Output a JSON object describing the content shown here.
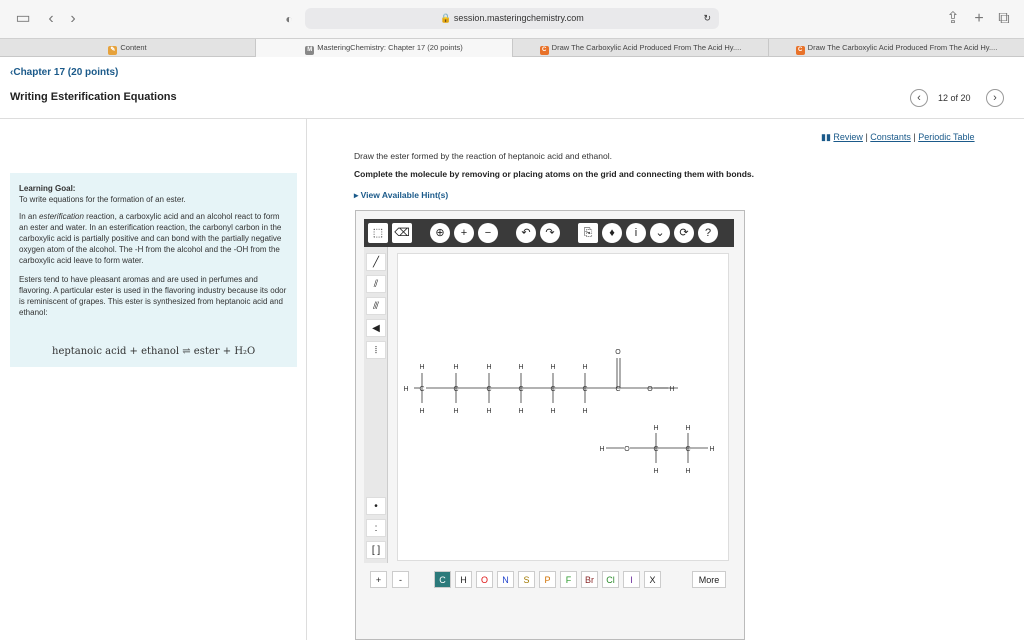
{
  "browser": {
    "url": "session.masteringchemistry.com",
    "tabs": [
      {
        "label": "Content",
        "icon": "content-icon"
      },
      {
        "label": "MasteringChemistry: Chapter 17 (20 points)",
        "icon": "m-icon"
      },
      {
        "label": "Draw The Carboxylic Acid Produced From The Acid Hy....",
        "icon": "c-icon"
      },
      {
        "label": "Draw The Carboxylic Acid Produced From The Acid Hy....",
        "icon": "c-icon"
      }
    ]
  },
  "header": {
    "chapter_link": "Chapter 17 (20 points)",
    "title": "Writing Esterification Equations",
    "counter": "12 of 20"
  },
  "learning_goal": {
    "title": "Learning Goal:",
    "goal": "To write equations for the formation of an ester.",
    "para1_a": "In an ",
    "para1_term": "esterification",
    "para1_b": " reaction, a carboxylic acid and an alcohol react to form an ester and water. In an esterification reaction, the carbonyl carbon in the carboxylic acid is partially positive and can bond with the partially negative oxygen atom of the alcohol. The -H from the alcohol and the -OH from the carboxylic acid leave to form water.",
    "para2": "Esters tend to have pleasant aromas and are used in perfumes and flavoring. A particular ester is used in the flavoring industry because its odor is reminiscent of grapes. This ester is synthesized from heptanoic acid and ethanol:",
    "equation": "heptanoic acid + ethanol ⇌ ester + H₂O"
  },
  "links": {
    "review": "Review",
    "constants": "Constants",
    "periodic": "Periodic Table"
  },
  "question": "Draw the ester formed by the reaction of heptanoic acid and ethanol.",
  "instruction": "Complete the molecule by removing or placing atoms on the grid and connecting them with bonds.",
  "hints": "View Available Hint(s)",
  "atom_buttons": [
    {
      "label": "C",
      "color": "#ffffff",
      "bg": "#2c7a7b"
    },
    {
      "label": "H",
      "color": "#222222",
      "bg": "#ffffff"
    },
    {
      "label": "O",
      "color": "#d11",
      "bg": "#ffffff"
    },
    {
      "label": "N",
      "color": "#2244cc",
      "bg": "#ffffff"
    },
    {
      "label": "S",
      "color": "#a07800",
      "bg": "#ffffff"
    },
    {
      "label": "P",
      "color": "#d07000",
      "bg": "#ffffff"
    },
    {
      "label": "F",
      "color": "#2a9a2a",
      "bg": "#ffffff"
    },
    {
      "label": "Br",
      "color": "#8a2a2a",
      "bg": "#ffffff"
    },
    {
      "label": "Cl",
      "color": "#2a8a2a",
      "bg": "#ffffff"
    },
    {
      "label": "I",
      "color": "#6a2a9a",
      "bg": "#ffffff"
    },
    {
      "label": "X",
      "color": "#222222",
      "bg": "#ffffff"
    }
  ],
  "charge_buttons": [
    "+",
    "-"
  ],
  "more_label": "More",
  "molecule_atoms": {
    "H": "H",
    "C": "C",
    "O": "O"
  }
}
